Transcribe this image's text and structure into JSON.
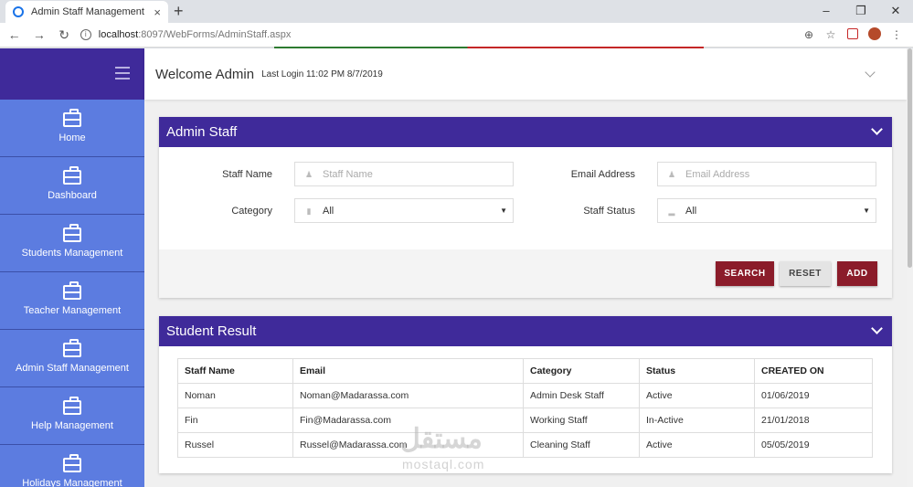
{
  "browser": {
    "tab_title": "Admin Staff Management",
    "tab_close": "×",
    "new_tab": "+",
    "url_host": "localhost",
    "url_path": ":8097/WebForms/AdminStaff.aspx",
    "window_controls": [
      "–",
      "❐",
      "✕"
    ]
  },
  "header": {
    "welcome": "Welcome Admin",
    "last_login": "Last Login 11:02 PM 8/7/2019"
  },
  "sidebar": {
    "items": [
      {
        "label": "Home"
      },
      {
        "label": "Dashboard"
      },
      {
        "label": "Students Management"
      },
      {
        "label": "Teacher Management"
      },
      {
        "label": "Admin Staff Management"
      },
      {
        "label": "Help Management"
      },
      {
        "label": "Holidays Management"
      }
    ]
  },
  "filter_panel": {
    "title": "Admin Staff",
    "staff_name_label": "Staff Name",
    "staff_name_placeholder": "Staff Name",
    "email_label": "Email Address",
    "email_placeholder": "Email Address",
    "category_label": "Category",
    "category_value": "All",
    "status_label": "Staff Status",
    "status_value": "All",
    "search_button": "SEARCH",
    "reset_button": "RESET",
    "add_button": "ADD"
  },
  "results_panel": {
    "title": "Student Result",
    "columns": [
      "Staff Name",
      "Email",
      "Category",
      "Status",
      "CREATED ON"
    ],
    "rows": [
      [
        "Noman",
        "Noman@Madarassa.com",
        "Admin Desk Staff",
        "Active",
        "01/06/2019"
      ],
      [
        "Fin",
        "Fin@Madarassa.com",
        "Working Staff",
        "In-Active",
        "21/01/2018"
      ],
      [
        "Russel",
        "Russel@Madarassa.com",
        "Cleaning Staff",
        "Active",
        "05/05/2019"
      ]
    ]
  },
  "watermark": {
    "arabic": "مستقل",
    "latin": "mostaql.com"
  },
  "colors": {
    "header_purple": "#3f2a9a",
    "sidebar_blue": "#5c7ce0",
    "button_red": "#8b1c2a"
  }
}
